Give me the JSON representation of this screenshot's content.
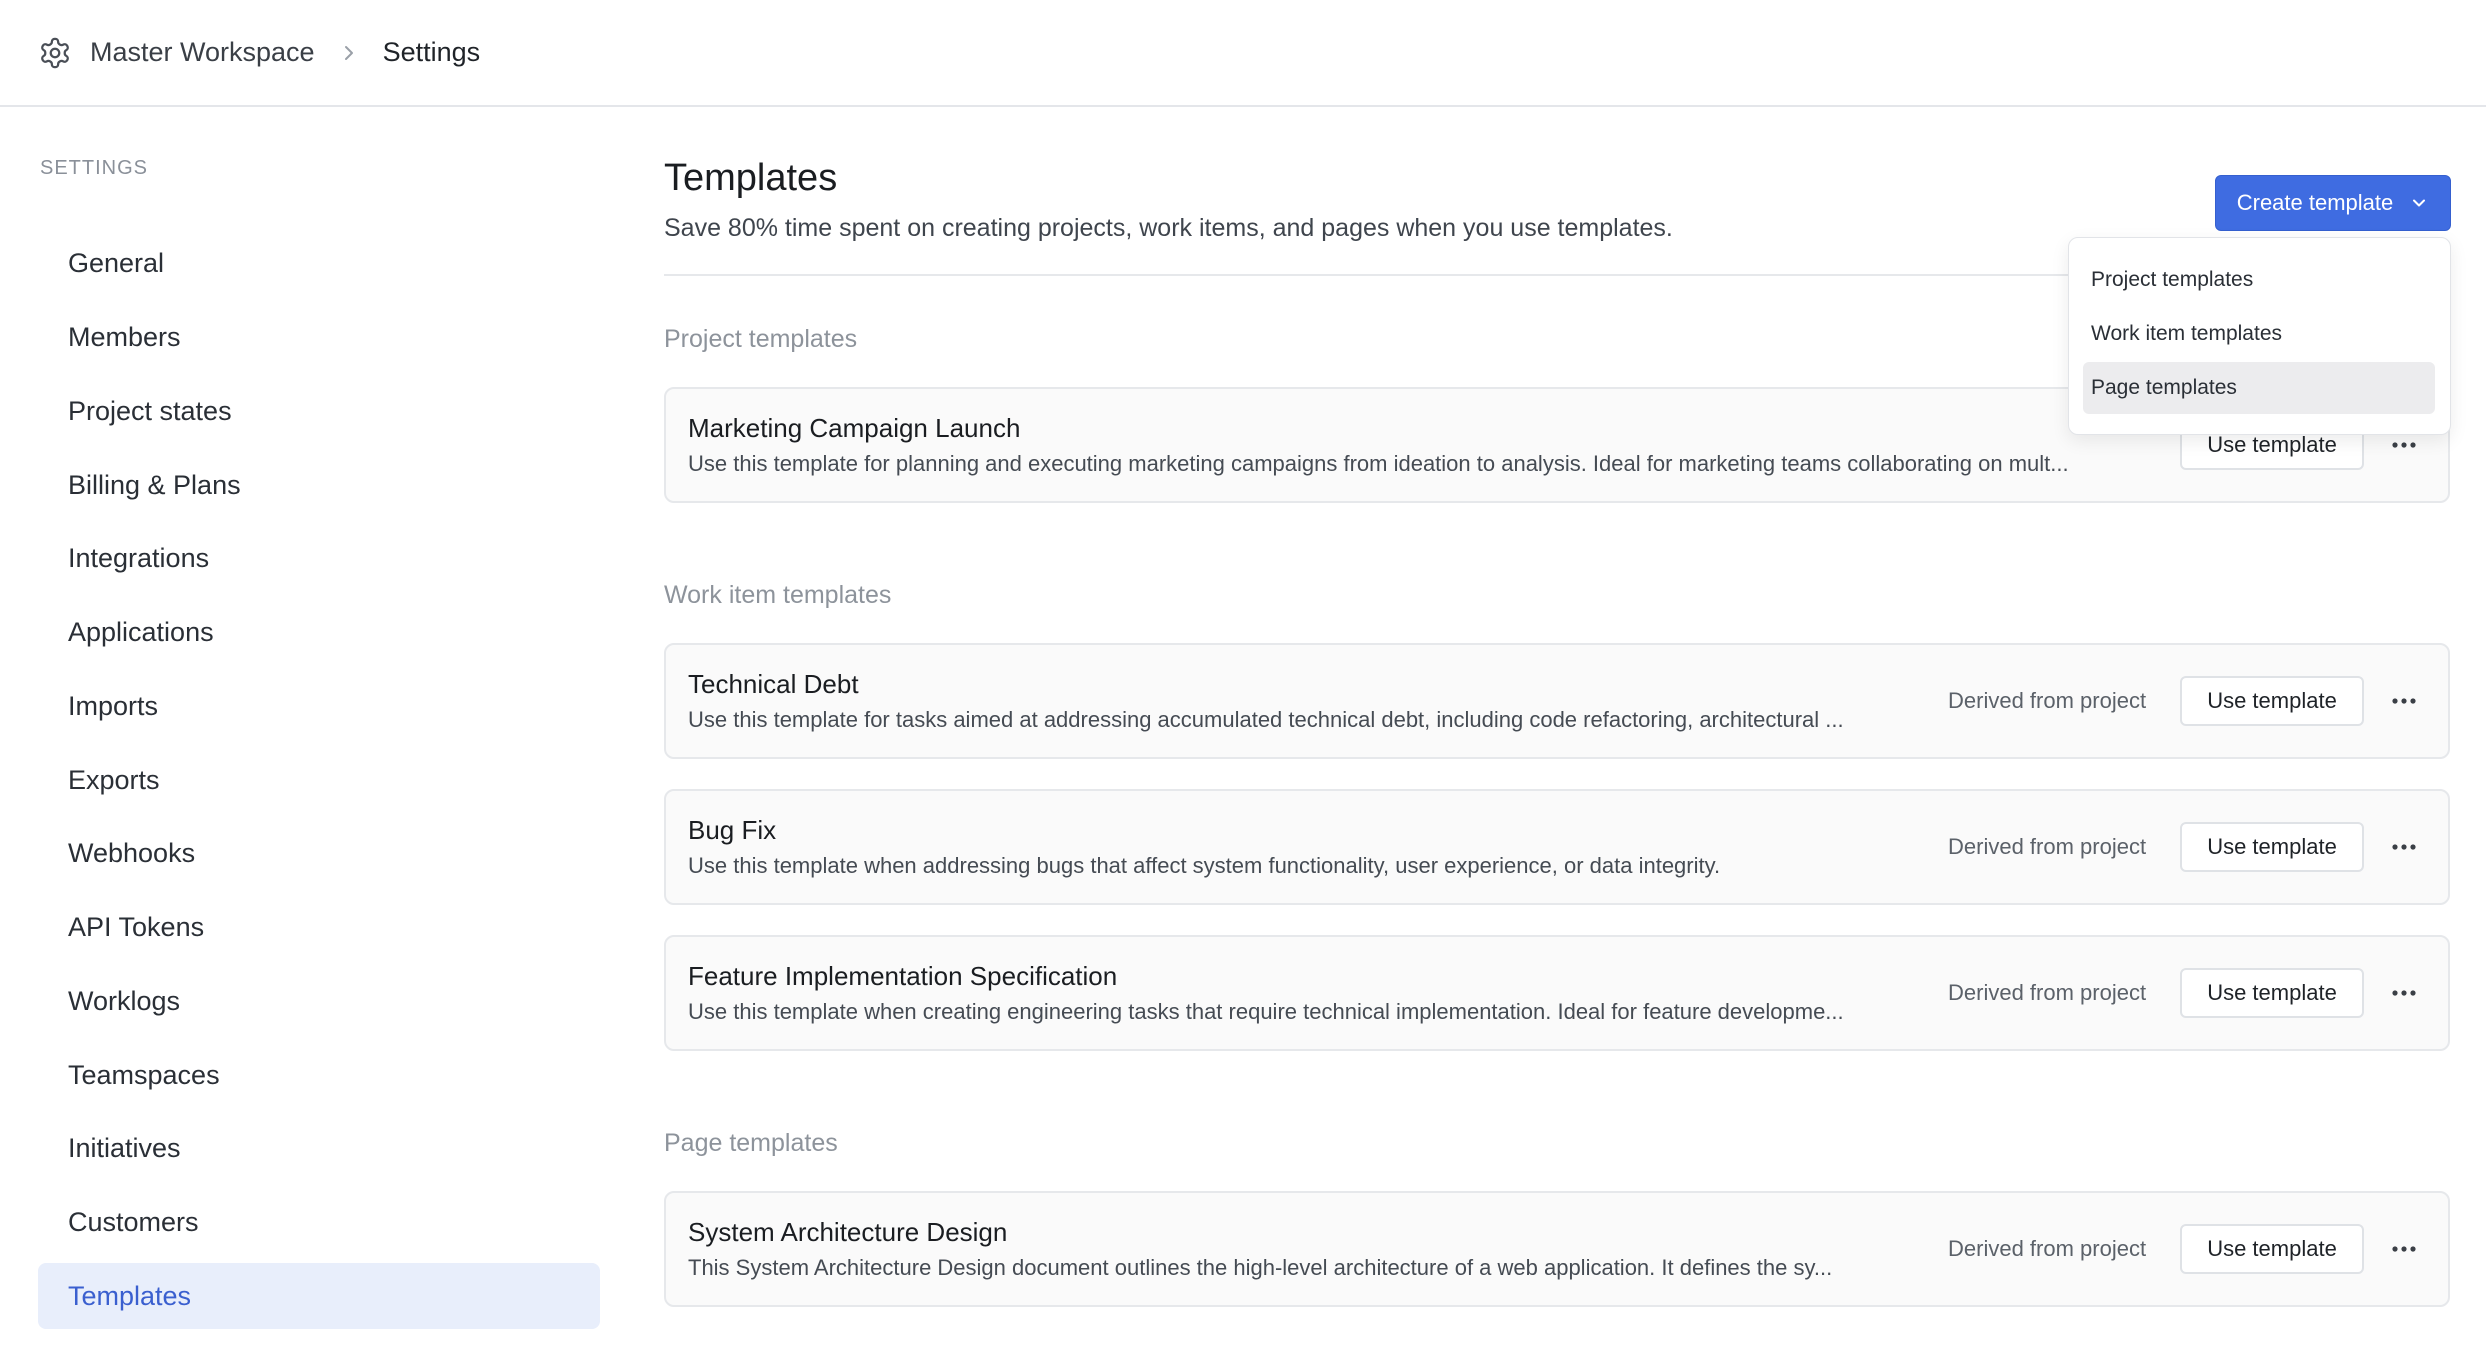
{
  "breadcrumb": {
    "workspace": "Master Workspace",
    "current": "Settings"
  },
  "sidebar": {
    "heading": "SETTINGS",
    "items": [
      {
        "label": "General"
      },
      {
        "label": "Members"
      },
      {
        "label": "Project states"
      },
      {
        "label": "Billing & Plans"
      },
      {
        "label": "Integrations"
      },
      {
        "label": "Applications"
      },
      {
        "label": "Imports"
      },
      {
        "label": "Exports"
      },
      {
        "label": "Webhooks"
      },
      {
        "label": "API Tokens"
      },
      {
        "label": "Worklogs"
      },
      {
        "label": "Teamspaces"
      },
      {
        "label": "Initiatives"
      },
      {
        "label": "Customers"
      },
      {
        "label": "Templates",
        "active": true
      }
    ]
  },
  "main": {
    "title": "Templates",
    "subtitle": "Save 80% time spent on creating projects, work items, and pages when you use templates.",
    "create_button": "Create template",
    "create_menu": [
      "Project templates",
      "Work item templates",
      "Page templates"
    ],
    "create_menu_hovered": "Page templates",
    "use_label": "Use template",
    "derived_label": "Derived from project",
    "sections": {
      "project": {
        "title": "Project templates",
        "cards": [
          {
            "name": "Marketing Campaign Launch",
            "desc": "Use this template for planning and executing marketing campaigns from ideation to analysis. Ideal for marketing teams collaborating on mult..."
          }
        ]
      },
      "work_item": {
        "title": "Work item templates",
        "cards": [
          {
            "name": "Technical Debt",
            "desc": "Use this template for tasks aimed at addressing accumulated technical debt, including code refactoring, architectural ..."
          },
          {
            "name": "Bug Fix",
            "desc": "Use this template when addressing bugs that affect system functionality, user experience, or data integrity."
          },
          {
            "name": "Feature Implementation Specification",
            "desc": "Use this template when creating engineering tasks that require technical implementation. Ideal for feature developme..."
          }
        ]
      },
      "page": {
        "title": "Page templates",
        "cards": [
          {
            "name": "System Architecture Design",
            "desc": "This System Architecture Design document outlines the high-level architecture of a web application. It defines the sy..."
          }
        ]
      }
    }
  },
  "colors": {
    "accent": "#3f6ce1",
    "active_bg": "#e8eefb",
    "active_text": "#3a5fcf"
  }
}
